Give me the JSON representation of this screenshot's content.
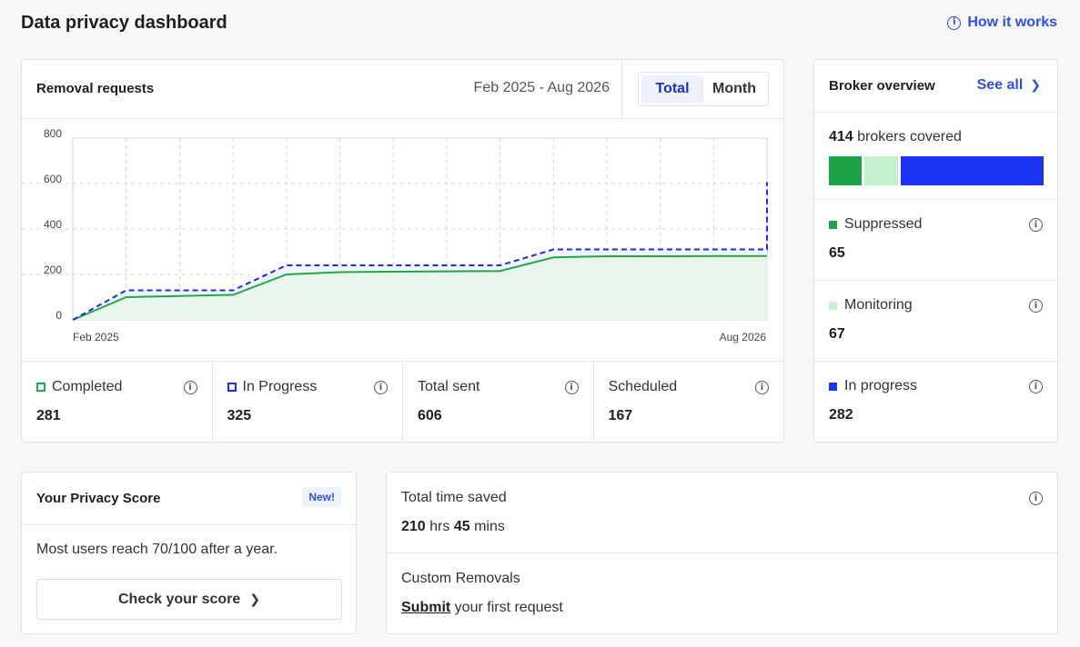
{
  "page": {
    "title": "Data privacy dashboard",
    "how_it_works": "How it works"
  },
  "removal_requests": {
    "title": "Removal requests",
    "date_range": "Feb 2025 - Aug 2026",
    "toggle": {
      "total": "Total",
      "month": "Month",
      "selected": "Total"
    },
    "stats": [
      {
        "label": "Completed",
        "value": "281"
      },
      {
        "label": "In Progress",
        "value": "325"
      },
      {
        "label": "Total sent",
        "value": "606"
      },
      {
        "label": "Scheduled",
        "value": "167"
      }
    ]
  },
  "chart_data": {
    "type": "area",
    "x_tick_labels": [
      "Feb 2025",
      "Aug 2026"
    ],
    "ylim": [
      0,
      800
    ],
    "yticks": [
      0,
      200,
      400,
      600,
      800
    ],
    "grid": true,
    "series": [
      {
        "name": "Completed",
        "color": "#22a84a",
        "style": "solid",
        "values": [
          0,
          100,
          110,
          200,
          210,
          212,
          215,
          275,
          280,
          280,
          281,
          281,
          281,
          281
        ]
      },
      {
        "name": "In Progress",
        "color": "#1c2fe0",
        "style": "dashed",
        "values": [
          0,
          130,
          130,
          240,
          240,
          240,
          240,
          310,
          310,
          310,
          310,
          310,
          310,
          606
        ]
      }
    ],
    "x_points": [
      0,
      1,
      3,
      4,
      5,
      6,
      8,
      9,
      10,
      11,
      12,
      12.5,
      13,
      13
    ]
  },
  "broker_overview": {
    "title": "Broker overview",
    "see_all": "See all",
    "covered_count": "414",
    "covered_text": "brokers covered",
    "bar": [
      {
        "name": "Suppressed",
        "value": 65,
        "color": "#1fa347"
      },
      {
        "name": "Monitoring",
        "value": 67,
        "color": "#c4f1cf"
      },
      {
        "name": "In progress",
        "value": 282,
        "color": "#1c33f2"
      }
    ],
    "items": [
      {
        "label": "Suppressed",
        "value": "65",
        "color": "#1fa347"
      },
      {
        "label": "Monitoring",
        "value": "67",
        "color": "#c4f1cf"
      },
      {
        "label": "In progress",
        "value": "282",
        "color": "#1c33f2"
      }
    ]
  },
  "privacy_score": {
    "title": "Your Privacy Score",
    "badge": "New!",
    "text": "Most users reach 70/100 after a year.",
    "button": "Check your score"
  },
  "time_saved": {
    "label": "Total time saved",
    "hours": "210",
    "hours_unit": "hrs",
    "mins": "45",
    "mins_unit": "mins"
  },
  "custom_removals": {
    "label": "Custom Removals",
    "link": "Submit",
    "rest": "your first request"
  }
}
